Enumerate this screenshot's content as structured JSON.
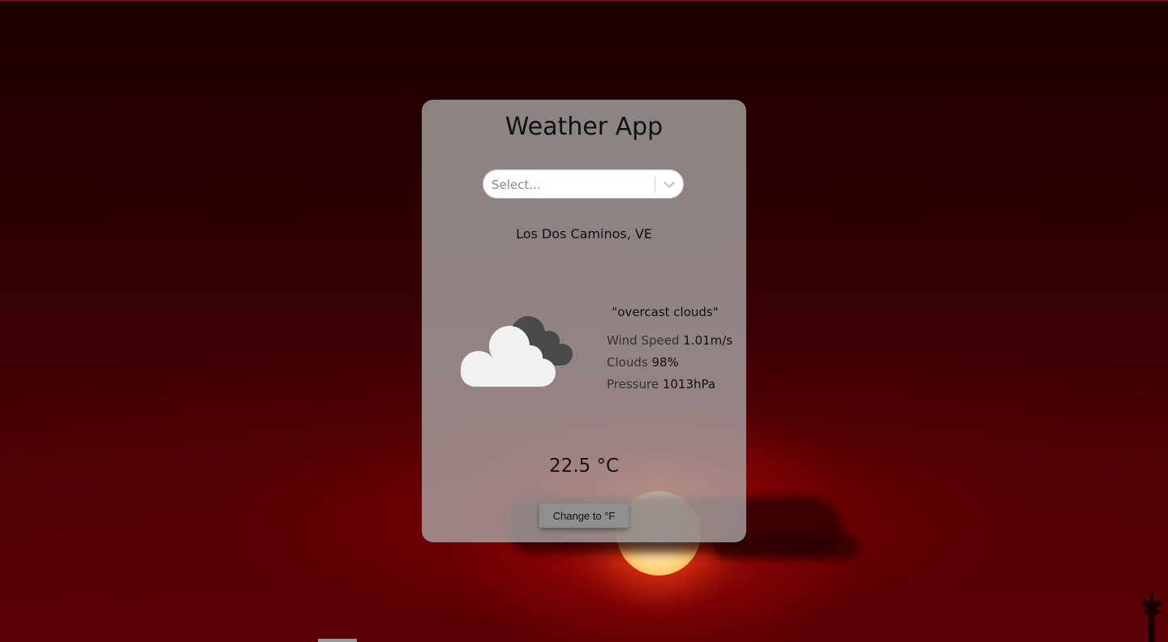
{
  "app": {
    "title": "Weather App"
  },
  "search": {
    "placeholder": "Select..."
  },
  "location": "Los Dos Caminos, VE",
  "weather": {
    "description": "\"overcast clouds\"",
    "icon": "overcast-clouds-icon",
    "wind_label": "Wind Speed",
    "wind_value": "1.01m/s",
    "clouds_label": "Clouds",
    "clouds_value": "98%",
    "pressure_label": "Pressure",
    "pressure_value": "1013hPa",
    "temperature": "22.5 °C"
  },
  "controls": {
    "unit_toggle_label": "Change to °F"
  },
  "colors": {
    "card_background": "#afafaf",
    "background_dark": "#2a0003",
    "background_red": "#b00a0a",
    "sun": "#ffd98a"
  }
}
